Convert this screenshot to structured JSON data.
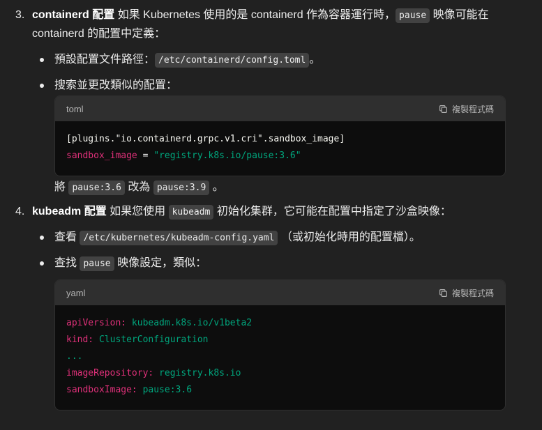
{
  "item3": {
    "number": "3.",
    "bold": "containerd 配置",
    "text1": " 如果 Kubernetes 使用的是 containerd 作為容器運行時，",
    "code": "pause",
    "text2": " 映像可能在",
    "text3": "containerd 的配置中定義：",
    "bullet1": {
      "text": "預設配置文件路徑：",
      "code": "/etc/containerd/config.toml",
      "suffix": "。"
    },
    "bullet2": {
      "text": "搜索並更改類似的配置："
    },
    "codeblock": {
      "lang": "toml",
      "copy_label": "複製程式碼",
      "line1": "[plugins.\"io.containerd.grpc.v1.cri\".sandbox_image]",
      "line2_key": "sandbox_image",
      "line2_op": " = ",
      "line2_val": "\"registry.k8s.io/pause:3.6\""
    },
    "after": {
      "prefix": "將",
      "code1": "pause:3.6",
      "middle": "改為",
      "code2": "pause:3.9",
      "suffix": "。"
    }
  },
  "item4": {
    "number": "4.",
    "bold": "kubeadm 配置",
    "text1": " 如果您使用",
    "code": "kubeadm",
    "text2": "初始化集群，它可能在配置中指定了沙盒映像：",
    "bullet1": {
      "text": "查看",
      "code": "/etc/kubernetes/kubeadm-config.yaml",
      "suffix": "（或初始化時用的配置檔）。"
    },
    "bullet2": {
      "text": "查找",
      "code": "pause",
      "suffix": "映像設定，類似："
    },
    "codeblock": {
      "lang": "yaml",
      "copy_label": "複製程式碼",
      "l1_key": "apiVersion:",
      "l1_val": " kubeadm.k8s.io/v1beta2",
      "l2_key": "kind:",
      "l2_val": " ClusterConfiguration",
      "l3": "...",
      "l4_key": "imageRepository:",
      "l4_val": " registry.k8s.io",
      "l5_key": "sandboxImage:",
      "l5_val": " pause:3.6"
    }
  }
}
